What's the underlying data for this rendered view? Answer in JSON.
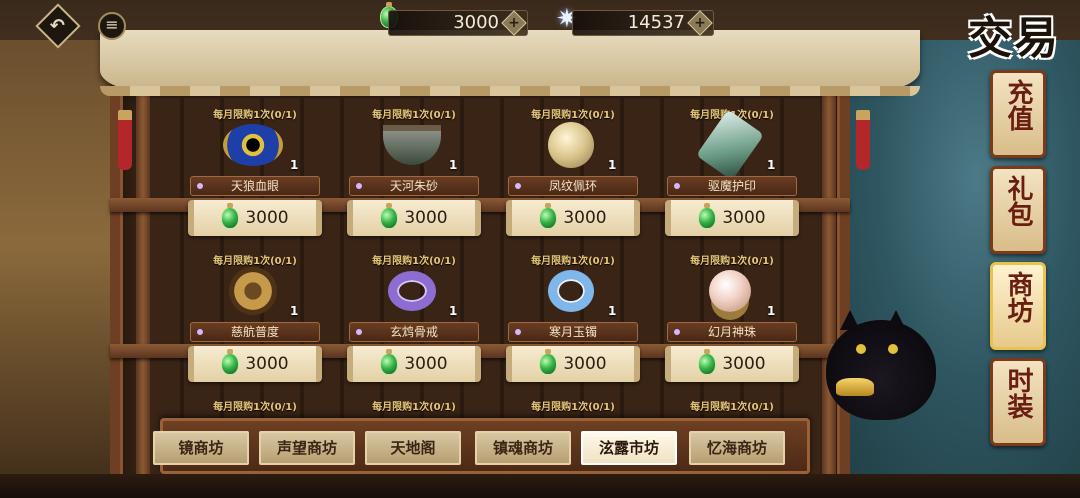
{
  "topbar": {
    "back_icon": "back-arrow-icon",
    "menu_icon": "menu-icon",
    "jade_amount": "3000",
    "star_amount": "14537",
    "plus": "+"
  },
  "title": "交易",
  "side_tabs": [
    {
      "label": "充值",
      "active": false
    },
    {
      "label": "礼包",
      "active": false
    },
    {
      "label": "商坊",
      "active": true
    },
    {
      "label": "时装",
      "active": false
    }
  ],
  "items": [
    {
      "limit": "每月限购1次(0/1)",
      "name": "天狼血眼",
      "qty": "1",
      "price": "3000",
      "icon": "eye-gem-icon"
    },
    {
      "limit": "每月限购1次(0/1)",
      "name": "天河朱砂",
      "qty": "1",
      "price": "3000",
      "icon": "necklace-icon"
    },
    {
      "limit": "每月限购1次(0/1)",
      "name": "凤纹佩环",
      "qty": "1",
      "price": "3000",
      "icon": "phoenix-pendant-icon"
    },
    {
      "limit": "每月限购1次(0/1)",
      "name": "驱魔护印",
      "qty": "1",
      "price": "3000",
      "icon": "jade-seal-icon"
    },
    {
      "limit": "每月限购1次(0/1)",
      "name": "慈航普度",
      "qty": "1",
      "price": "3000",
      "icon": "bronze-disc-icon"
    },
    {
      "limit": "每月限购1次(0/1)",
      "name": "玄鸩骨戒",
      "qty": "1",
      "price": "3000",
      "icon": "purple-ring-icon"
    },
    {
      "limit": "每月限购1次(0/1)",
      "name": "寒月玉镯",
      "qty": "1",
      "price": "3000",
      "icon": "blue-bracelet-icon"
    },
    {
      "limit": "每月限购1次(0/1)",
      "name": "幻月神珠",
      "qty": "1",
      "price": "3000",
      "icon": "pearl-icon"
    }
  ],
  "row3_limits": [
    "每月限购1次(0/1)",
    "每月限购1次(0/1)",
    "每月限购1次(0/1)",
    "每月限购1次(0/1)"
  ],
  "bottom_tabs": [
    {
      "label": "镜商坊",
      "active": false
    },
    {
      "label": "声望商坊",
      "active": false
    },
    {
      "label": "天地阁",
      "active": false
    },
    {
      "label": "镇魂商坊",
      "active": false
    },
    {
      "label": "泫露市坊",
      "active": true
    },
    {
      "label": "忆海商坊",
      "active": false
    }
  ],
  "colors": {
    "accent": "#e6c77a",
    "frame": "#6e3f22",
    "tab_text": "#6a1e12"
  }
}
